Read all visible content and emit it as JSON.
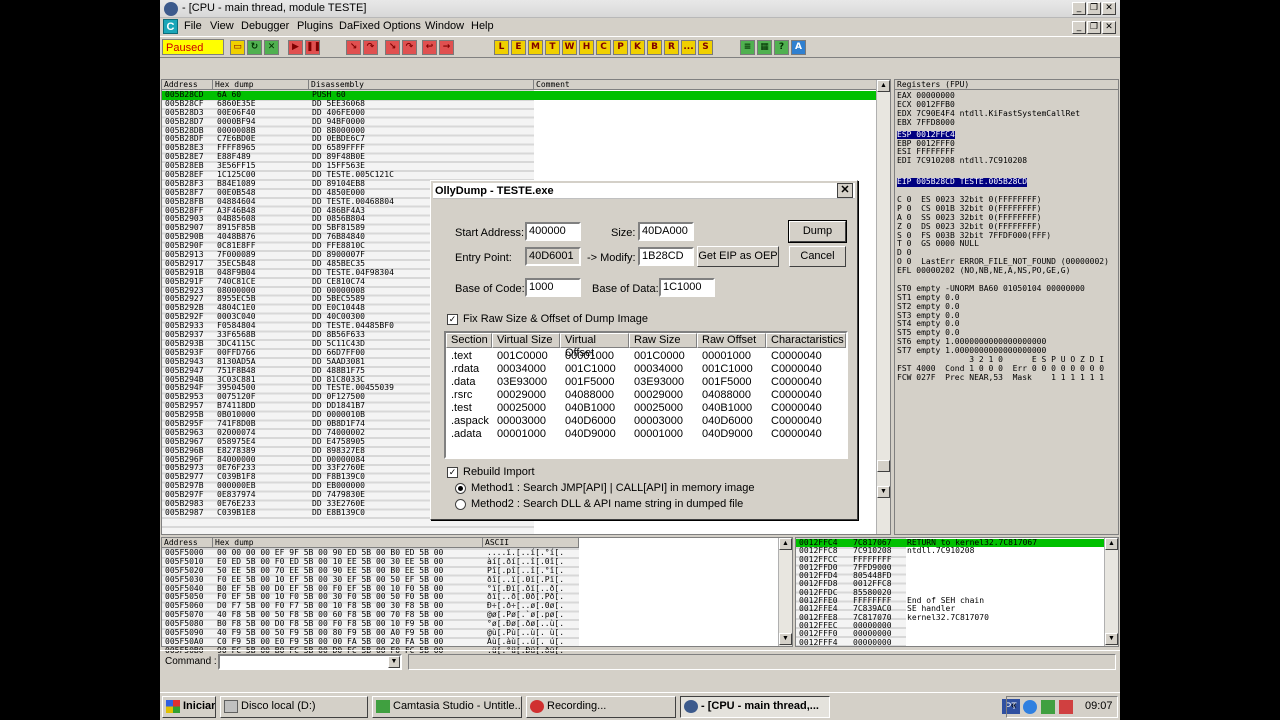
{
  "window": {
    "title": "- [CPU - main thread, module TESTE]"
  },
  "menu": [
    "File",
    "View",
    "Debugger",
    "Plugins",
    "DaFixed Options",
    "Window",
    "Help"
  ],
  "status": "Paused",
  "toolbar_letters": [
    "L",
    "E",
    "M",
    "T",
    "W",
    "H",
    "C",
    "P",
    "K",
    "B",
    "R",
    "...",
    "S"
  ],
  "cpu": {
    "headers": {
      "address": "Address",
      "hex": "Hex dump",
      "disasm": "Disassembly",
      "comment": "Comment"
    },
    "rows": [
      {
        "a": "005B28CD",
        "h": "6A 60",
        "d": "PUSH 60"
      },
      {
        "a": "005B28CF",
        "h": "6860E35E",
        "d": "DD 5EE36068"
      },
      {
        "a": "005B28D3",
        "h": "00E06F40",
        "d": "DD 406FE000"
      },
      {
        "a": "005B28D7",
        "h": "0000BF94",
        "d": "DD 94BF0000"
      },
      {
        "a": "005B28DB",
        "h": "0000008B",
        "d": "DD 8B000000"
      },
      {
        "a": "005B28DF",
        "h": "C7E6BD0E",
        "d": "DD 0EBDE6C7"
      },
      {
        "a": "005B28E3",
        "h": "FFFF8965",
        "d": "DD 6589FFFF"
      },
      {
        "a": "005B28E7",
        "h": "E88F489",
        "d": "DD 89F48B0E"
      },
      {
        "a": "005B28EB",
        "h": "3E56FF15",
        "d": "DD 15FF563E"
      },
      {
        "a": "005B28EF",
        "h": "1C125C00",
        "d": "DD TESTE.005C121C"
      },
      {
        "a": "005B28F3",
        "h": "B84E1089",
        "d": "DD 89104EB8"
      },
      {
        "a": "005B28F7",
        "h": "00E0B548",
        "d": "DD 4850E000"
      },
      {
        "a": "005B28FB",
        "h": "04884604",
        "d": "DD TESTE.00468804"
      },
      {
        "a": "005B28FF",
        "h": "A3F46B48",
        "d": "DD 486BF4A3"
      },
      {
        "a": "005B2903",
        "h": "04B85608",
        "d": "DD 0856B804"
      },
      {
        "a": "005B2907",
        "h": "8915F85B",
        "d": "DD 5BF81589"
      },
      {
        "a": "005B290B",
        "h": "4048B876",
        "d": "DD 76B84840"
      },
      {
        "a": "005B290F",
        "h": "0C81E8FF",
        "d": "DD FFE8810C"
      },
      {
        "a": "005B2913",
        "h": "7F000089",
        "d": "DD 8900007F"
      },
      {
        "a": "005B2917",
        "h": "35EC5B48",
        "d": "DD 485BEC35"
      },
      {
        "a": "005B291B",
        "h": "048F9B04",
        "d": "DD TESTE.04F98304"
      },
      {
        "a": "005B291F",
        "h": "740C81CE",
        "d": "DD CE810C74"
      },
      {
        "a": "005B2923",
        "h": "08000000",
        "d": "DD 00000008"
      },
      {
        "a": "005B2927",
        "h": "8955EC5B",
        "d": "DD 5BEC5589"
      },
      {
        "a": "005B292B",
        "h": "4804C1E0",
        "d": "DD E0C10448"
      },
      {
        "a": "005B292F",
        "h": "0003C040",
        "d": "DD 40C00300"
      },
      {
        "a": "005B2933",
        "h": "F0584804",
        "d": "DD TESTE.04485BF0"
      },
      {
        "a": "005B2937",
        "h": "33F6568B",
        "d": "DD 8B56F633"
      },
      {
        "a": "005B293B",
        "h": "3DC4115C",
        "d": "DD 5C11C43D"
      },
      {
        "a": "005B293F",
        "h": "00FFD766",
        "d": "DD 66D7FF00"
      },
      {
        "a": "005B2943",
        "h": "8130AD5A",
        "d": "DD 5AAD3081"
      },
      {
        "a": "005B2947",
        "h": "751F8B48",
        "d": "DD 488B1F75"
      },
      {
        "a": "005B294B",
        "h": "3C03C881",
        "d": "DD 81C8033C"
      },
      {
        "a": "005B294F",
        "h": "39504500",
        "d": "DD TESTE.00455039"
      },
      {
        "a": "005B2953",
        "h": "0075120F",
        "d": "DD 0F127500"
      },
      {
        "a": "005B2957",
        "h": "B74118DD",
        "d": "DD DD1841B7"
      },
      {
        "a": "005B295B",
        "h": "0B010000",
        "d": "DD 0000010B"
      },
      {
        "a": "005B295F",
        "h": "741F8D0B",
        "d": "DD 0B8D1F74"
      },
      {
        "a": "005B2963",
        "h": "02000074",
        "d": "DD 74000002"
      },
      {
        "a": "005B2967",
        "h": "058975E4",
        "d": "DD E4758905"
      },
      {
        "a": "005B296B",
        "h": "E8278389",
        "d": "DD 898327E8"
      },
      {
        "a": "005B296F",
        "h": "84000000",
        "d": "DD 00000084"
      },
      {
        "a": "005B2973",
        "h": "0E76F233",
        "d": "DD 33F2760E"
      },
      {
        "a": "005B2977",
        "h": "C039B1F8",
        "d": "DD F8B139C0"
      },
      {
        "a": "005B297B",
        "h": "000000EB",
        "d": "DD EB000000"
      },
      {
        "a": "005B297F",
        "h": "0E837974",
        "d": "DD 7479830E"
      },
      {
        "a": "005B2983",
        "h": "0E76E233",
        "d": "DD 33E2760E"
      },
      {
        "a": "005B2987",
        "h": "C039B1E8",
        "d": "DD E8B139C0"
      }
    ]
  },
  "registers": {
    "header": "Registers (FPU)",
    "lines": [
      {
        "t": "EAX 00000000",
        "hl": false
      },
      {
        "t": "ECX 0012FFB0",
        "hl": false
      },
      {
        "t": "EDX 7C90E4F4 ntdll.KiFastSystemCallRet",
        "hl": false
      },
      {
        "t": "EBX 7FFD8000",
        "hl": false
      },
      {
        "t": "ESP 0012FFC4",
        "hl": true
      },
      {
        "t": "EBP 0012FFF0",
        "hl": false
      },
      {
        "t": "ESI FFFFFFFF",
        "hl": false
      },
      {
        "t": "EDI 7C910208 ntdll.7C910208",
        "hl": false
      },
      {
        "t": "",
        "hl": false
      },
      {
        "t": "EIP 005B28CD TESTE.005B28CD",
        "hl": true
      },
      {
        "t": "",
        "hl": false
      },
      {
        "t": "C 0  ES 0023 32bit 0(FFFFFFFF)",
        "hl": false
      },
      {
        "t": "P 0  CS 001B 32bit 0(FFFFFFFF)",
        "hl": false
      },
      {
        "t": "A 0  SS 0023 32bit 0(FFFFFFFF)",
        "hl": false
      },
      {
        "t": "Z 0  DS 0023 32bit 0(FFFFFFFF)",
        "hl": false
      },
      {
        "t": "S 0  FS 003B 32bit 7FFDF000(FFF)",
        "hl": false
      },
      {
        "t": "T 0  GS 0000 NULL",
        "hl": false
      },
      {
        "t": "D 0",
        "hl": false
      },
      {
        "t": "O 0  LastErr ERROR_FILE_NOT_FOUND (00000002)",
        "hl": false
      },
      {
        "t": "EFL 00000202 (NO,NB,NE,A,NS,PO,GE,G)",
        "hl": false
      },
      {
        "t": "",
        "hl": false
      },
      {
        "t": "ST0 empty -UNORM BA60 01050104 00000000",
        "hl": false
      },
      {
        "t": "ST1 empty 0.0",
        "hl": false
      },
      {
        "t": "ST2 empty 0.0",
        "hl": false
      },
      {
        "t": "ST3 empty 0.0",
        "hl": false
      },
      {
        "t": "ST4 empty 0.0",
        "hl": false
      },
      {
        "t": "ST5 empty 0.0",
        "hl": false
      },
      {
        "t": "ST6 empty 1.0000000000000000000",
        "hl": false
      },
      {
        "t": "ST7 empty 1.0000000000000000000",
        "hl": false
      },
      {
        "t": "               3 2 1 0      E S P U O Z D I",
        "hl": false
      },
      {
        "t": "FST 4000  Cond 1 0 0 0  Err 0 0 0 0 0 0 0 0",
        "hl": false
      },
      {
        "t": "FCW 027F  Prec NEAR,53  Mask    1 1 1 1 1 1",
        "hl": false
      }
    ]
  },
  "dump": {
    "headers": {
      "address": "Address",
      "hex": "Hex dump",
      "ascii": "ASCII"
    },
    "rows": [
      {
        "a": "005F5000",
        "h": "00 00 00 00 EF 9F 5B 00 90 ED 5B 00 B0 ED 5B 00",
        "s": "....ï.[..í[.°í[."
      },
      {
        "a": "005F5010",
        "h": "E0 ED 5B 00 F0 ED 5B 00 10 EE 5B 00 30 EE 5B 00",
        "s": "àí[.ðí[..î[.0î[."
      },
      {
        "a": "005F5020",
        "h": "50 EE 5B 00 70 EE 5B 00 90 EE 5B 00 B0 EE 5B 00",
        "s": "Pî[.pî[..î[.°î[."
      },
      {
        "a": "005F5030",
        "h": "F0 EE 5B 00 10 EF 5B 00 30 EF 5B 00 50 EF 5B 00",
        "s": "ðî[..ï[.0ï[.Pï[."
      },
      {
        "a": "005F5040",
        "h": "B0 EF 5B 00 D0 EF 5B 00 F0 EF 5B 00 10 F0 5B 00",
        "s": "°ï[.Ðï[.ðï[..ð[."
      },
      {
        "a": "005F5050",
        "h": "F0 EF 5B 00 10 F0 5B 00 30 F0 5B 00 50 F0 5B 00",
        "s": "ðï[..ð[.0ð[.Pð[."
      },
      {
        "a": "005F5060",
        "h": "D0 F7 5B 00 F0 F7 5B 00 10 F8 5B 00 30 F8 5B 00",
        "s": "Ð÷[.ð÷[..ø[.0ø[."
      },
      {
        "a": "005F5070",
        "h": "40 F8 5B 00 50 F8 5B 00 60 F8 5B 00 70 F8 5B 00",
        "s": "@ø[.Pø[.`ø[.pø[."
      },
      {
        "a": "005F5080",
        "h": "B0 F8 5B 00 D0 F8 5B 00 F0 F8 5B 00 10 F9 5B 00",
        "s": "°ø[.Ðø[.ðø[..ù[."
      },
      {
        "a": "005F5090",
        "h": "40 F9 5B 00 50 F9 5B 00 80 F9 5B 00 A0 F9 5B 00",
        "s": "@ù[.Pù[..ù[. ù[."
      },
      {
        "a": "005F50A0",
        "h": "C0 F9 5B 00 E0 F9 5B 00 00 FA 5B 00 20 FA 5B 00",
        "s": "Àù[.àù[..ú[. ú[."
      },
      {
        "a": "005F50B0",
        "h": "90 FC 5B 00 B0 FC 5B 00 D0 FC 5B 00 F0 FC 5B 00",
        "s": ".ü[.°ü[.Ðü[.ðü[."
      }
    ]
  },
  "stack": {
    "rows": [
      {
        "a": "0012FFC4",
        "v": "7C817067",
        "c": "RETURN to kernel32.7C817067",
        "hl": true
      },
      {
        "a": "0012FFC8",
        "v": "7C910208",
        "c": "ntdll.7C910208",
        "hl": false
      },
      {
        "a": "0012FFCC",
        "v": "FFFFFFFF",
        "c": "",
        "hl": false
      },
      {
        "a": "0012FFD0",
        "v": "7FFD9000",
        "c": "",
        "hl": false
      },
      {
        "a": "0012FFD4",
        "v": "805448FD",
        "c": "",
        "hl": false
      },
      {
        "a": "0012FFD8",
        "v": "0012FFC8",
        "c": "",
        "hl": false
      },
      {
        "a": "0012FFDC",
        "v": "85580020",
        "c": "",
        "hl": false
      },
      {
        "a": "0012FFE0",
        "v": "FFFFFFFF",
        "c": "End of SEH chain",
        "hl": false
      },
      {
        "a": "0012FFE4",
        "v": "7C839AC0",
        "c": "SE handler",
        "hl": false
      },
      {
        "a": "0012FFE8",
        "v": "7C817070",
        "c": "kernel32.7C817070",
        "hl": false
      },
      {
        "a": "0012FFEC",
        "v": "00000000",
        "c": "",
        "hl": false
      },
      {
        "a": "0012FFF0",
        "v": "00000000",
        "c": "",
        "hl": false
      },
      {
        "a": "0012FFF4",
        "v": "00000000",
        "c": "",
        "hl": false
      }
    ]
  },
  "dialog": {
    "title": "OllyDump - TESTE.exe",
    "start_address_label": "Start Address:",
    "start_address": "400000",
    "size_label": "Size:",
    "size": "40DA000",
    "dump_btn": "Dump",
    "entry_point_label": "Entry Point:",
    "entry_point": "40D6001",
    "modify_label": "-> Modify:",
    "modify": "1B28CD",
    "get_eip_btn": "Get EIP as OEP",
    "cancel_btn": "Cancel",
    "base_code_label": "Base of Code:",
    "base_code": "1000",
    "base_data_label": "Base of Data:",
    "base_data": "1C1000",
    "fix_raw_label": "Fix Raw Size & Offset of Dump Image",
    "columns": [
      "Section",
      "Virtual Size",
      "Virtual Offset",
      "Raw Size",
      "Raw Offset",
      "Charactaristics"
    ],
    "sections": [
      [
        ".text",
        "001C0000",
        "00001000",
        "001C0000",
        "00001000",
        "C0000040"
      ],
      [
        ".rdata",
        "00034000",
        "001C1000",
        "00034000",
        "001C1000",
        "C0000040"
      ],
      [
        ".data",
        "03E93000",
        "001F5000",
        "03E93000",
        "001F5000",
        "C0000040"
      ],
      [
        ".rsrc",
        "00029000",
        "04088000",
        "00029000",
        "04088000",
        "C0000040"
      ],
      [
        ".test",
        "00025000",
        "040B1000",
        "00025000",
        "040B1000",
        "C0000040"
      ],
      [
        ".aspack",
        "00003000",
        "040D6000",
        "00003000",
        "040D6000",
        "C0000040"
      ],
      [
        ".adata",
        "00001000",
        "040D9000",
        "00001000",
        "040D9000",
        "C0000040"
      ]
    ],
    "rebuild_import_label": "Rebuild Import",
    "method1_label": "Method1 : Search JMP[API] | CALL[API] in memory image",
    "method2_label": "Method2 : Search DLL & API name string in dumped file"
  },
  "command": {
    "label": "Command :"
  },
  "taskbar": {
    "start": "Iniciar",
    "tasks": [
      "Disco local (D:)",
      "Camtasia Studio - Untitle...",
      "Recording...",
      "- [CPU - main thread,..."
    ],
    "lang": "PT",
    "clock": "09:07"
  },
  "colors": {
    "selection": "#00c000",
    "reg_highlight": "#000080",
    "paused_bg": "#ffff00"
  }
}
